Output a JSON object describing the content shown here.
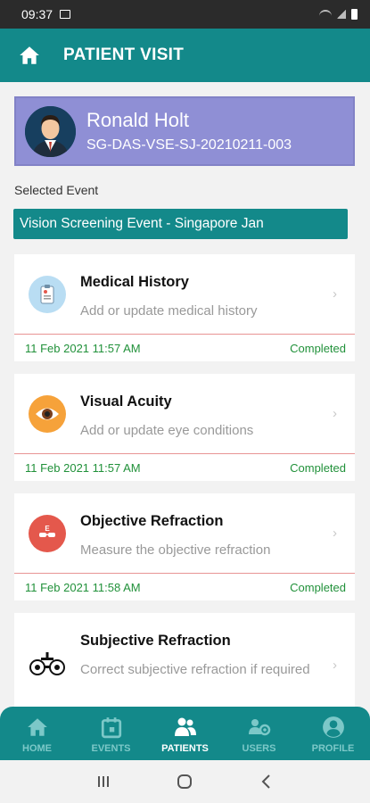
{
  "status_bar": {
    "time": "09:37"
  },
  "header": {
    "title": "PATIENT VISIT"
  },
  "patient": {
    "name": "Ronald Holt",
    "id": "SG-DAS-VSE-SJ-20210211-003"
  },
  "selected_event": {
    "label": "Selected Event",
    "value": "Vision Screening Event -  Singapore Jan"
  },
  "tasks": [
    {
      "title": "Medical History",
      "desc": "Add or update medical history",
      "date": "11 Feb 2021 11:57 AM",
      "status": "Completed",
      "icon": "clipboard-icon"
    },
    {
      "title": "Visual Acuity",
      "desc": "Add or update eye conditions",
      "date": "11 Feb 2021 11:57 AM",
      "status": "Completed",
      "icon": "eye-icon"
    },
    {
      "title": "Objective Refraction",
      "desc": "Measure the objective refraction",
      "date": "11 Feb 2021 11:58 AM",
      "status": "Completed",
      "icon": "eye-chart-icon"
    },
    {
      "title": "Subjective Refraction",
      "desc": "Correct subjective refraction if required",
      "icon": "phoropter-icon"
    }
  ],
  "nav": {
    "home": "HOME",
    "events": "EVENTS",
    "patients": "PATIENTS",
    "users": "USERS",
    "profile": "PROFILE",
    "active": "patients"
  },
  "colors": {
    "primary": "#13898a",
    "patient_card": "#8f8fd5",
    "completed": "#21913a"
  }
}
